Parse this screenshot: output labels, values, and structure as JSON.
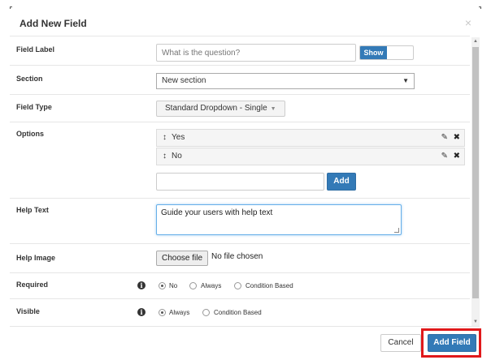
{
  "modal": {
    "title": "Add New Field",
    "close_label": "×"
  },
  "field_label": {
    "label": "Field Label",
    "placeholder": "What is the question?",
    "show_label": "Show"
  },
  "section": {
    "label": "Section",
    "value": "New section",
    "arrow": "▼"
  },
  "field_type": {
    "label": "Field Type",
    "value": "Standard Dropdown - Single",
    "caret": "▼"
  },
  "options": {
    "label": "Options",
    "items": [
      {
        "label": "Yes",
        "drag_icon": "↕",
        "edit_icon": "✎",
        "delete_icon": "✖"
      },
      {
        "label": "No",
        "drag_icon": "↕",
        "edit_icon": "✎",
        "delete_icon": "✖"
      }
    ],
    "new_option_value": "",
    "add_label": "Add"
  },
  "help_text": {
    "label": "Help Text",
    "value": "Guide your users with help text"
  },
  "help_image": {
    "label": "Help Image",
    "choose_label": "Choose file",
    "status": "No file chosen"
  },
  "required": {
    "label": "Required",
    "info": "i",
    "choices": [
      "No",
      "Always",
      "Condition Based"
    ],
    "selected": "No"
  },
  "visible": {
    "label": "Visible",
    "info": "i",
    "choices": [
      "Always",
      "Condition Based"
    ],
    "selected": "Always"
  },
  "footer": {
    "cancel_label": "Cancel",
    "add_field_label": "Add Field"
  },
  "colors": {
    "primary": "#337ab7",
    "highlight": "#e0191b"
  },
  "icons": {
    "scroll_up": "▲",
    "scroll_down": "▼"
  }
}
